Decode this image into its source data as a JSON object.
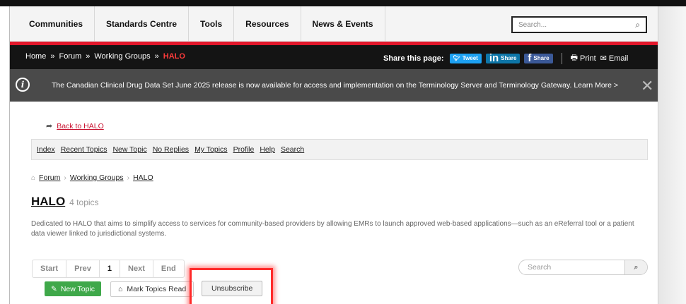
{
  "main_nav": {
    "items": [
      "Communities",
      "Standards Centre",
      "Tools",
      "Resources",
      "News & Events"
    ],
    "search_placeholder": "Search..."
  },
  "breadcrumb_bar": {
    "items": [
      "Home",
      "Forum",
      "Working Groups",
      "HALO"
    ],
    "separator": "»",
    "share_label": "Share this page:",
    "share_buttons": {
      "twitter": "Tweet",
      "linkedin": "Share",
      "facebook": "Share"
    },
    "print": "Print",
    "email": "Email"
  },
  "alert": {
    "message": "The Canadian Clinical Drug Data Set June 2025 release is now available for access and implementation on the Terminology Server and Terminology Gateway. Learn More >"
  },
  "back_link": "Back to HALO",
  "forum_nav": [
    "Index",
    "Recent Topics",
    "New Topic",
    "No Replies",
    "My Topics",
    "Profile",
    "Help",
    "Search"
  ],
  "forum_breadcrumb": [
    "Forum",
    "Working Groups",
    "HALO"
  ],
  "forum": {
    "title": "HALO",
    "topic_count": "4 topics",
    "description": "Dedicated to HALO that aims to simplify access to services for community-based providers by allowing EMRs to launch approved web-based applications—such as an eReferral tool or a patient data viewer linked to jurisdictional systems."
  },
  "pager": [
    "Start",
    "Prev",
    "1",
    "Next",
    "End"
  ],
  "forum_search_placeholder": "Search",
  "actions": {
    "new_topic": "New Topic",
    "mark_read": "Mark Topics Read",
    "unsubscribe": "Unsubscribe"
  },
  "colors": {
    "brand_red": "#e2172b",
    "dark_bar": "#141414",
    "alert_bg": "#4a4a4a",
    "green": "#3fa84a",
    "highlight": "#ff2a2a"
  },
  "icons": [
    "search-icon",
    "info-icon",
    "close-icon",
    "share-arrow-icon",
    "home-icon",
    "edit-icon",
    "inbox-icon",
    "print-icon",
    "email-icon"
  ]
}
